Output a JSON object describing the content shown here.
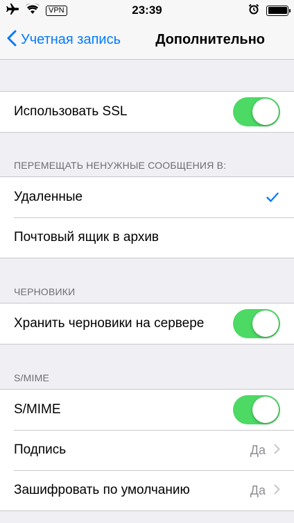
{
  "status_bar": {
    "vpn": "VPN",
    "time": "23:39",
    "icons": [
      "airplane-icon",
      "wifi-icon",
      "alarm-icon",
      "battery-icon"
    ]
  },
  "nav": {
    "back_label": "Учетная запись",
    "title": "Дополнительно"
  },
  "ssl": {
    "label": "Использовать SSL",
    "enabled": true
  },
  "move_section": {
    "header": "ПЕРЕМЕЩАТЬ НЕНУЖНЫЕ СООБЩЕНИЯ В:",
    "options": [
      {
        "label": "Удаленные",
        "selected": true
      },
      {
        "label": "Почтовый ящик в архив",
        "selected": false
      }
    ]
  },
  "drafts_section": {
    "header": "ЧЕРНОВИКИ",
    "store_label": "Хранить черновики на сервере",
    "enabled": true
  },
  "smime_section": {
    "header": "S/MIME",
    "smime_label": "S/MIME",
    "smime_enabled": true,
    "sign_label": "Подпись",
    "sign_value": "Да",
    "encrypt_label": "Зашифровать по умолчанию",
    "encrypt_value": "Да"
  },
  "colors": {
    "accent": "#007aff",
    "toggle_on": "#4cd964",
    "background": "#efeff4"
  }
}
